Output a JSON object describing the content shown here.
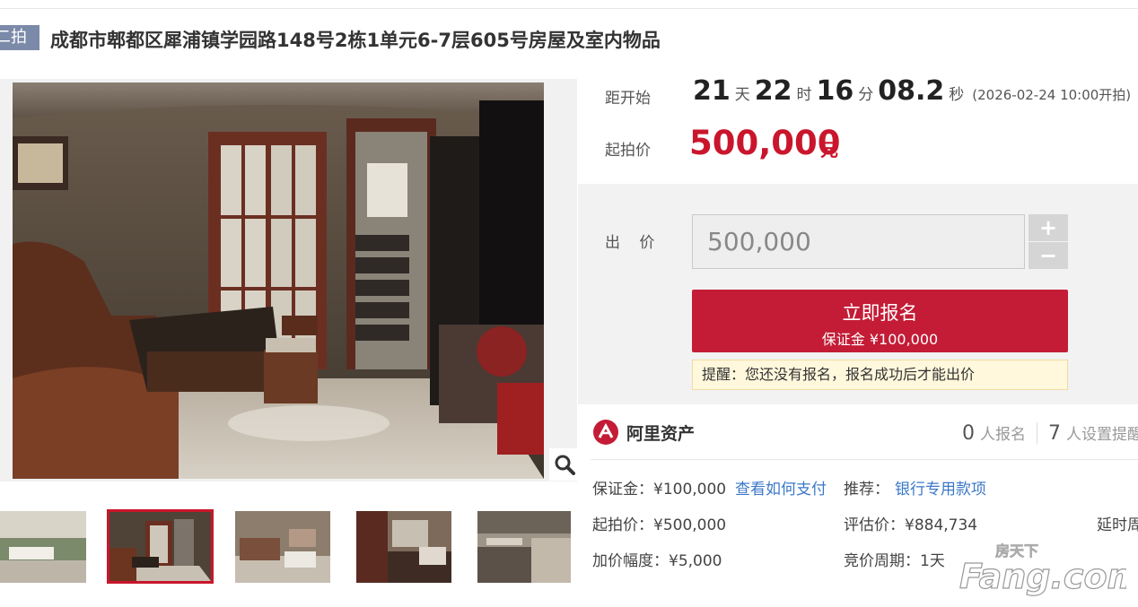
{
  "header": {
    "badge": "二拍",
    "title": "成都市郫都区犀浦镇学园路148号2栋1单元6-7层605号房屋及室内物品"
  },
  "countdown": {
    "label": "距开始",
    "days": "21",
    "days_unit": "天",
    "hours": "22",
    "hours_unit": "时",
    "minutes": "16",
    "minutes_unit": "分",
    "seconds": "08.2",
    "seconds_unit": "秒",
    "start_time": "(2026-02-24 10:00开拍)"
  },
  "starting_price": {
    "label": "起拍价",
    "value": "500,000",
    "unit": "元"
  },
  "bid": {
    "label": "出 价",
    "value": "500,000",
    "plus": "+",
    "minus": "−",
    "signup_label": "立即报名",
    "deposit_label": "保证金 ¥100,000",
    "notice": "提醒：您还没有报名，报名成功后才能出价"
  },
  "platform": {
    "name": "阿里资产",
    "signup_count": "0",
    "signup_text": "人报名",
    "reminder_count": "7",
    "reminder_text": "人设置提醒"
  },
  "details": {
    "deposit": "保证金：¥100,000",
    "how_to_pay": "查看如何支付",
    "recommend_label": "推荐：",
    "recommend_link": "银行专用款项",
    "start_price": "起拍价：¥500,000",
    "appraisal": "评估价：¥884,734",
    "delay": "延时周期",
    "increment": "加价幅度：¥5,000",
    "cycle": "竞价周期：1天"
  },
  "watermark": {
    "cn": "房天下",
    "en": "Fang.com"
  },
  "thumbnails": [
    "outdoor",
    "living-room",
    "living-room-2",
    "bedroom",
    "kitchen"
  ],
  "colors": {
    "accent_red": "#c41c36",
    "price_red": "#c9162c",
    "link_blue": "#3b78c8",
    "badge_gray": "#7b8aa8"
  }
}
